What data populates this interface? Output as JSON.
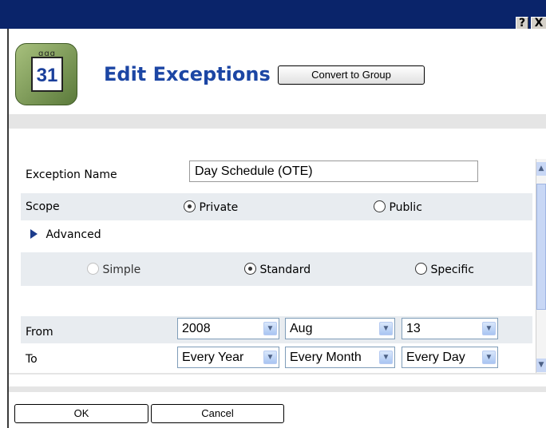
{
  "titlebar": {
    "help_glyph": "?",
    "close_glyph": "X"
  },
  "header": {
    "icon_day": "31",
    "title": "Edit Exceptions",
    "convert_label": "Convert to Group"
  },
  "form": {
    "exception_name_label": "Exception Name",
    "exception_name_value": "Day Schedule (OTE)",
    "scope_label": "Scope",
    "scope_private": "Private",
    "scope_public": "Public",
    "scope_selected": "Private",
    "advanced_label": "Advanced",
    "mode_simple": "Simple",
    "mode_standard": "Standard",
    "mode_specific": "Specific",
    "mode_selected": "Standard",
    "from_label": "From",
    "from_year": "2008",
    "from_month": "Aug",
    "from_day": "13",
    "to_label": "To",
    "to_year": "Every Year",
    "to_month": "Every Month",
    "to_day": "Every Day"
  },
  "footer": {
    "ok_label": "OK",
    "cancel_label": "Cancel"
  },
  "colors": {
    "titlebar": "#0a246a",
    "title_text": "#1c46a4",
    "row_shade": "#e8ecf0",
    "advanced_arrow": "#1c3c8c"
  }
}
